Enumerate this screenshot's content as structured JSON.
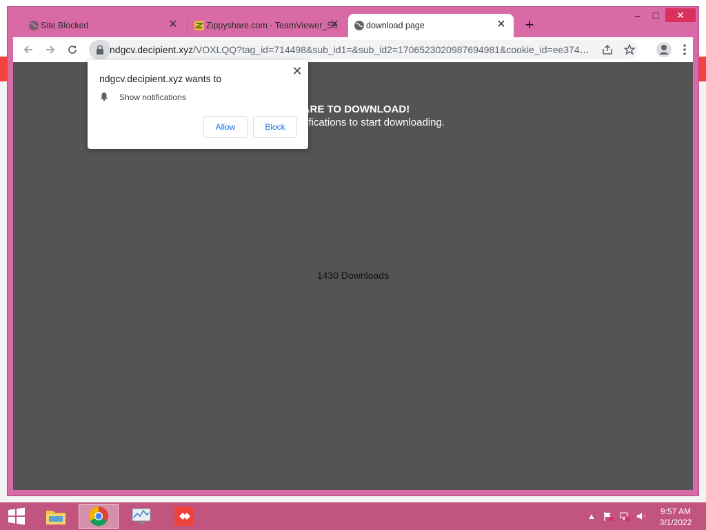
{
  "browser": {
    "tabs": [
      {
        "label": "Site Blocked",
        "favicon": "globe-icon"
      },
      {
        "label": "Zippyshare.com - TeamViewer_Se",
        "favicon": "zippyshare-icon"
      },
      {
        "label": "download page",
        "favicon": "globe-icon",
        "active": true
      }
    ],
    "new_tab": "+",
    "window_controls": {
      "minimize": "–",
      "maximize": "□",
      "close": "✕"
    },
    "url_host": "ndgcv.decipient.xyz",
    "url_path": "/VOXLQQ?tag_id=714498&sub_id1=&sub_id2=1706523020987694981&cookie_id=ee37461..."
  },
  "page": {
    "headline": "PARE TO DOWNLOAD!",
    "subline": "owser notifications to start downloading.",
    "downloads": "1430 Downloads",
    "background_color": "#545454"
  },
  "permission_popup": {
    "title": "ndgcv.decipient.xyz wants to",
    "description": "Show notifications",
    "allow_label": "Allow",
    "block_label": "Block",
    "close_label": "✕"
  },
  "taskbar": {
    "time": "9:57 AM",
    "date": "3/1/2022",
    "color": "#c2557f"
  }
}
